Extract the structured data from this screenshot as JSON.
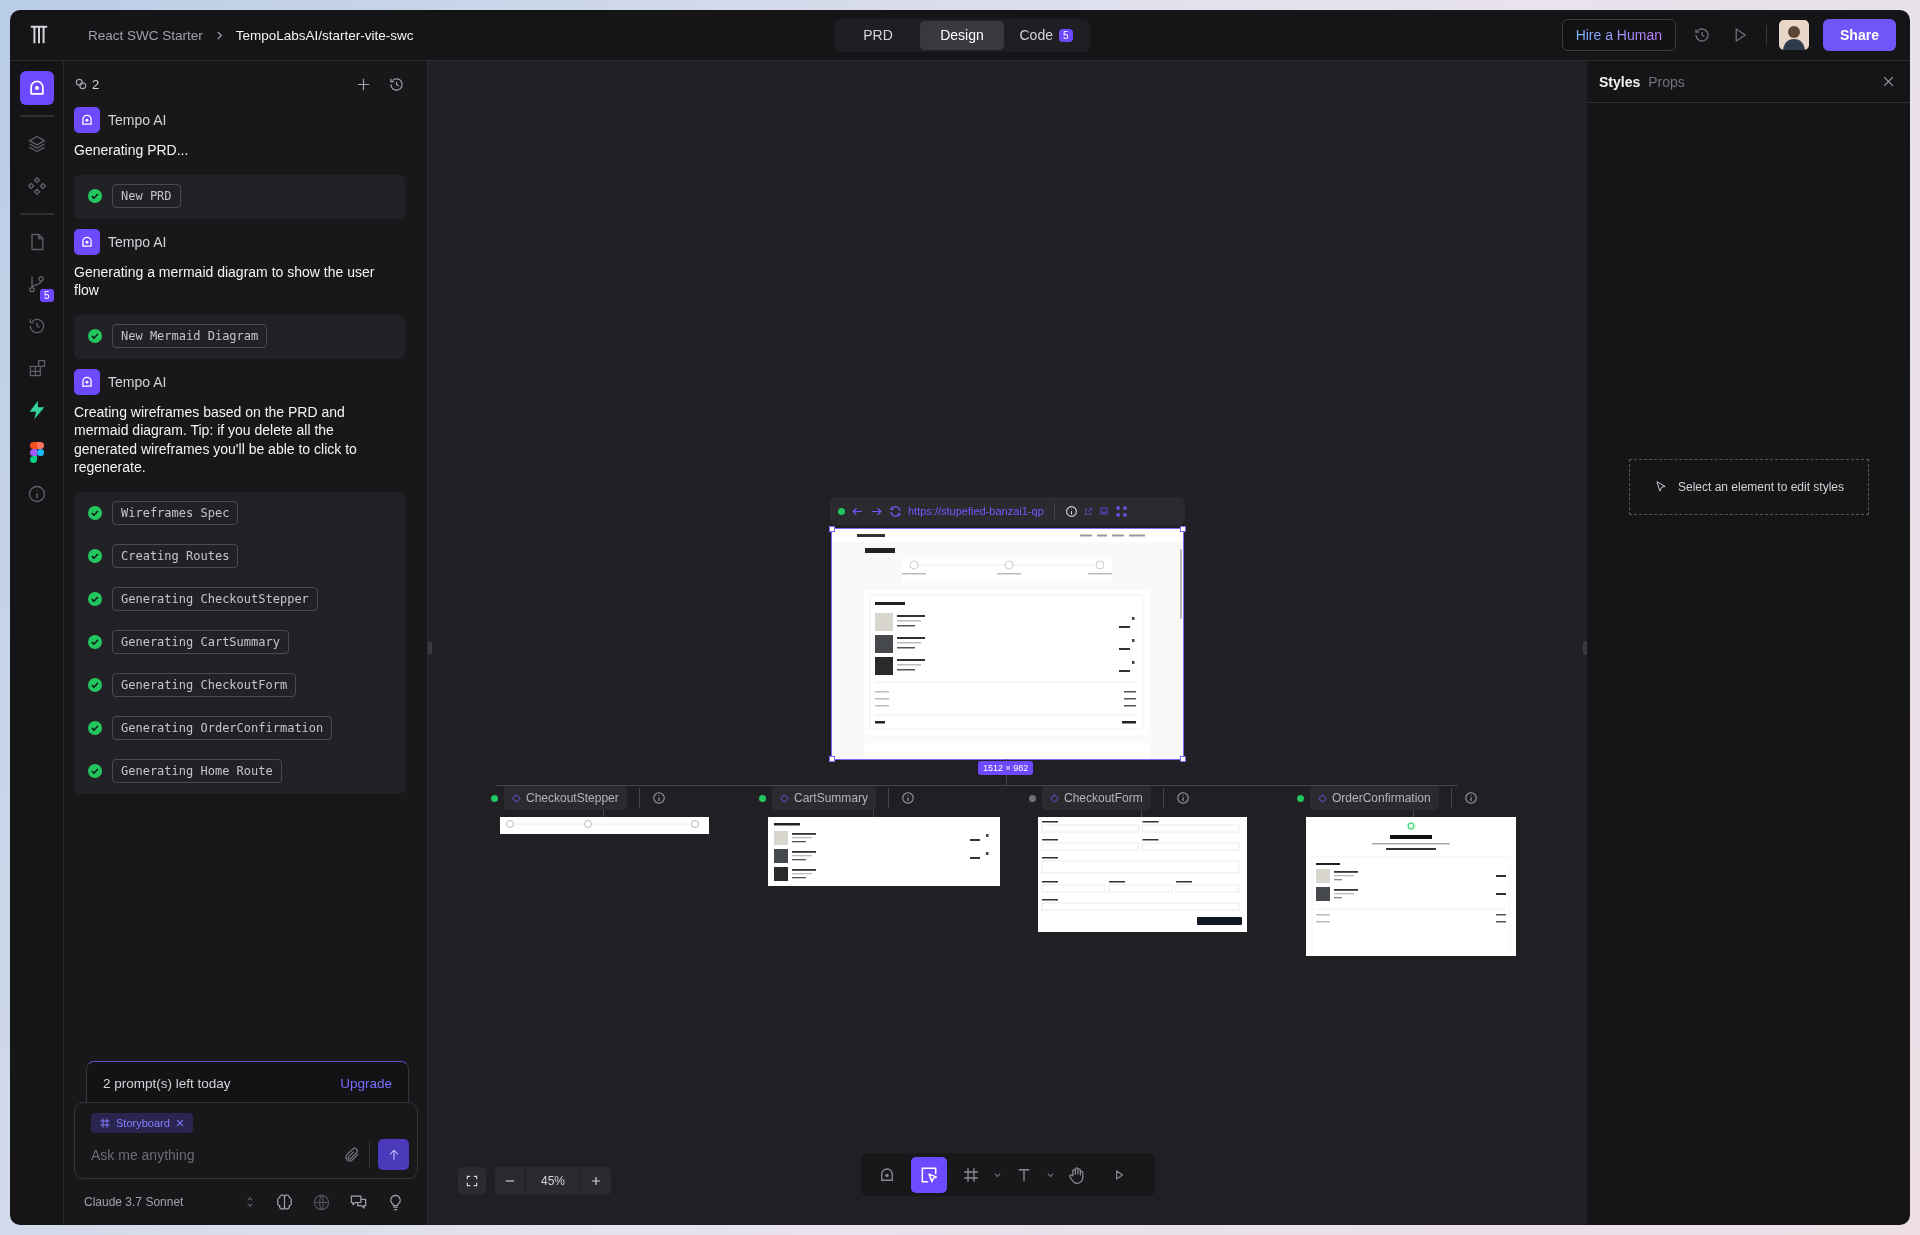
{
  "topbar": {
    "project": "React SWC Starter",
    "repo": "TempoLabsAI/starter-vite-swc",
    "modes": [
      {
        "label": "PRD",
        "selected": false
      },
      {
        "label": "Design",
        "selected": true
      },
      {
        "label": "Code",
        "selected": false,
        "badge": "5"
      }
    ],
    "hire_button": "Hire a Human",
    "share_button": "Share"
  },
  "rail": [
    {
      "selected": true
    },
    {
      "selected": false
    },
    {
      "selected": false
    },
    {
      "selected": false
    },
    {
      "selected": false,
      "badge": "5"
    },
    {
      "selected": false
    },
    {
      "selected": false
    },
    {
      "selected": false
    },
    {
      "selected": false
    },
    {
      "selected": false
    }
  ],
  "chat": {
    "thread_count": "2",
    "messages": [
      {
        "author": "Tempo AI",
        "text": "Generating PRD...",
        "steps": [
          {
            "label": "New PRD",
            "done": true
          }
        ]
      },
      {
        "author": "Tempo AI",
        "text": "Generating a mermaid diagram to show the user flow",
        "steps": [
          {
            "label": "New Mermaid Diagram",
            "done": true
          }
        ]
      },
      {
        "author": "Tempo AI",
        "text": "Creating wireframes based on the PRD and mermaid diagram. Tip: if you delete all the generated wireframes you'll be able to click to regenerate.",
        "steps": [
          {
            "label": "Wireframes Spec",
            "done": true
          },
          {
            "label": "Creating Routes",
            "done": true
          },
          {
            "label": "Generating CheckoutStepper",
            "done": true
          },
          {
            "label": "Generating CartSummary",
            "done": true
          },
          {
            "label": "Generating CheckoutForm",
            "done": true
          },
          {
            "label": "Generating OrderConfirmation",
            "done": true
          },
          {
            "label": "Generating Home Route",
            "done": true
          }
        ]
      }
    ],
    "quota": {
      "text": "2 prompt(s) left today",
      "action": "Upgrade"
    },
    "composer": {
      "chip": "Storyboard",
      "placeholder": "Ask me anything"
    },
    "model": "Claude 3.7 Sonnet"
  },
  "canvas": {
    "preview": {
      "url": "https://stupefied-banzai1-qp",
      "size": "1512 × 982"
    },
    "nodes": [
      {
        "name": "CheckoutStepper",
        "color": "#22c55e",
        "kind": "stepper"
      },
      {
        "name": "CartSummary",
        "color": "#22c55e",
        "kind": "cart"
      },
      {
        "name": "CheckoutForm",
        "color": "#71717a",
        "kind": "form"
      },
      {
        "name": "OrderConfirmation",
        "color": "#22c55e",
        "kind": "confirmation"
      }
    ],
    "zoom": "45%",
    "toolbar": [
      {
        "selected": false
      },
      {
        "selected": true
      },
      {
        "selected": false
      },
      {
        "selected": false
      },
      {
        "selected": false
      },
      {
        "selected": false
      }
    ]
  },
  "styles_panel": {
    "tabs": [
      {
        "label": "Styles",
        "selected": true
      },
      {
        "label": "Props",
        "selected": false
      }
    ],
    "hint": "Select an element to edit styles"
  }
}
